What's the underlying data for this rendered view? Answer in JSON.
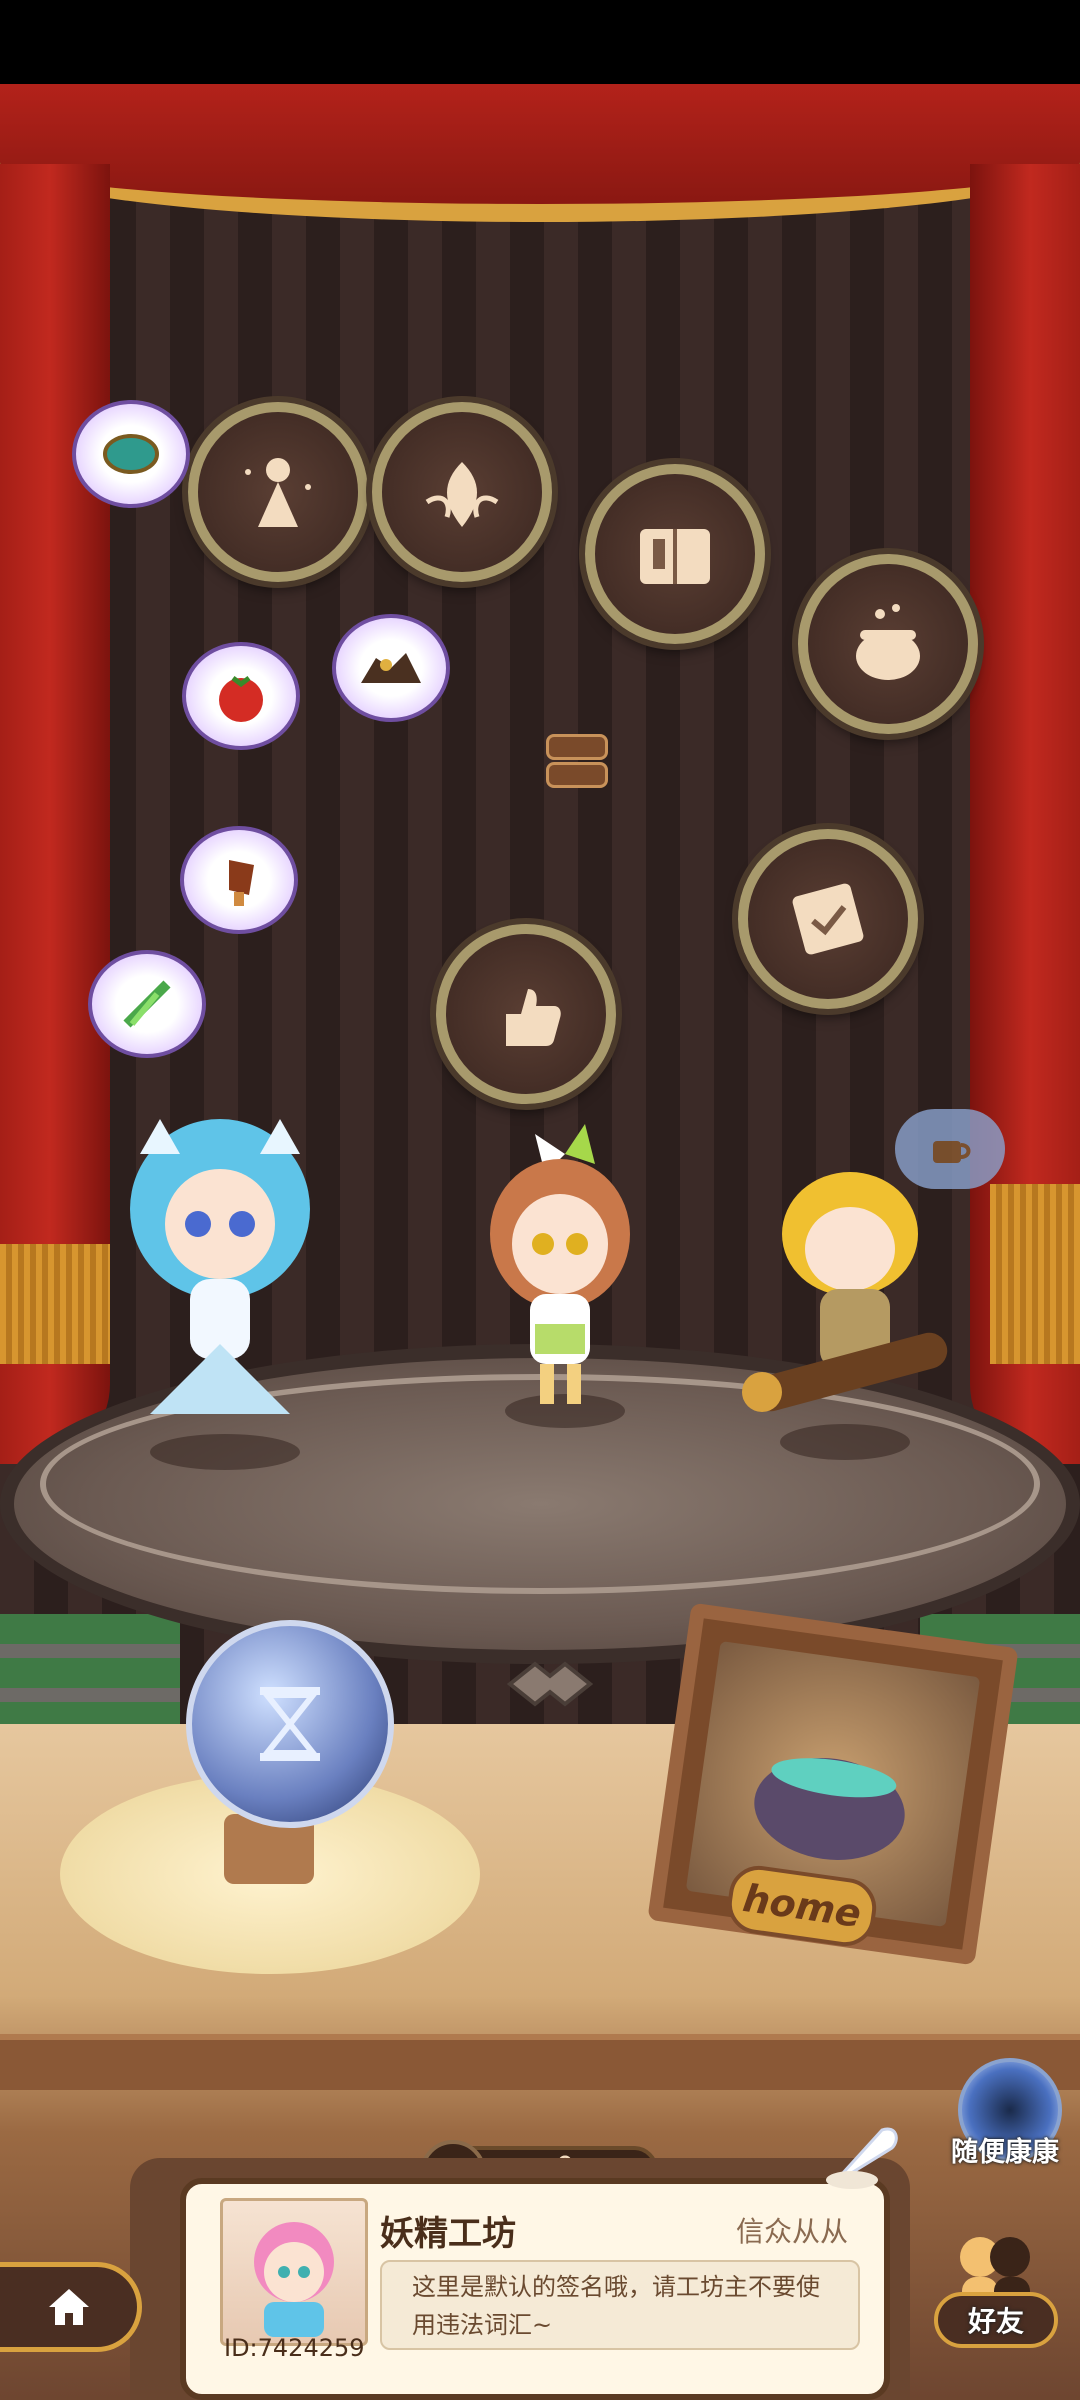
{
  "like_counter": {
    "value": "0",
    "icon": "thumbs-up-icon"
  },
  "workshop": {
    "name": "妖精工坊",
    "owner": "信众从从",
    "signature": "这里是默认的签名哦，请工坊主不要使用违法词汇~",
    "id_label": "ID:7424259"
  },
  "random_visit": {
    "label": "随便康康",
    "icon": "portal-icon"
  },
  "friends": {
    "label": "好友",
    "icon": "friends-icon"
  },
  "home_button": {
    "icon": "home-icon"
  },
  "home_frame": {
    "label": "home"
  },
  "hourglass_orb": {
    "icon": "hourglass-icon"
  },
  "badges": [
    "fairy-badge-icon",
    "leaf-badge-icon",
    "book-badge-icon",
    "cauldron-badge-icon",
    "scroll-badge-icon",
    "thumbs-up-badge-icon"
  ],
  "ingredients": [
    "clock-ingredient-icon",
    "tomato-ingredient-icon",
    "ore-ingredient-icon",
    "meat-ingredient-icon",
    "leek-ingredient-icon"
  ],
  "colors": {
    "curtain": "#b3221a",
    "gold": "#d9a23f",
    "panel": "#fff7e6",
    "panel_border": "#5a3a22"
  }
}
